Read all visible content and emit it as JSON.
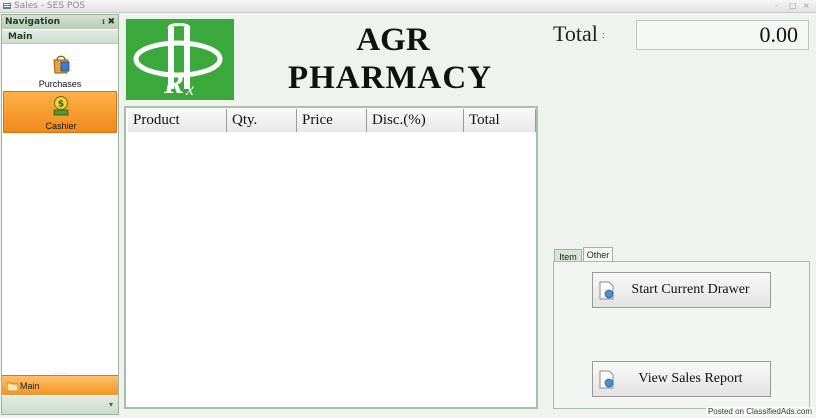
{
  "window": {
    "title": "Sales - SES POS",
    "controls": [
      "-",
      "□",
      "×"
    ]
  },
  "nav": {
    "header": "Navigation",
    "pin": "ᵻ",
    "close": "✖",
    "group": "Main",
    "items": [
      {
        "label": "Purchases",
        "icon": "purchases-bag-icon",
        "active": false
      },
      {
        "label": "Cashier",
        "icon": "cashier-money-icon",
        "active": true
      }
    ],
    "bottom_group": "Main",
    "grip": "....."
  },
  "store": {
    "name_line1": "AGR",
    "name_line2": "PHARMACY",
    "logo_icon": "rx-logo-icon",
    "logo_color": "#3aa83a"
  },
  "grid": {
    "columns": [
      "Product",
      "Qty.",
      "Price",
      "Disc.(%)",
      "Total"
    ],
    "rows": []
  },
  "total": {
    "label": "Total",
    "colon": ":",
    "value": "0.00"
  },
  "tabs": {
    "items": [
      "Item",
      "Other"
    ],
    "selected": "Other"
  },
  "buttons": {
    "start_drawer": "Start Current Drawer",
    "sales_report": "View Sales Report"
  },
  "watermark": "Posted on ClassifiedAds.com",
  "colors": {
    "accent_orange": "#f39423",
    "background": "#eef3ee"
  }
}
